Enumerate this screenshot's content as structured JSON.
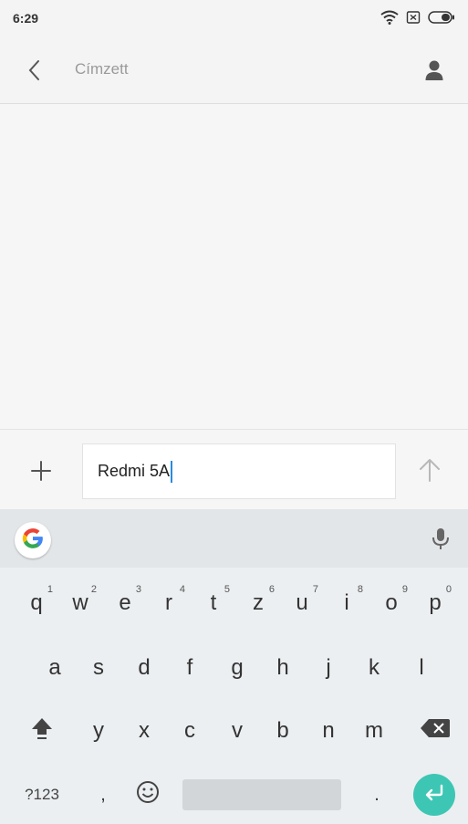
{
  "status_bar": {
    "time": "6:29",
    "icons": [
      "wifi-icon",
      "sim-off-icon",
      "battery-icon"
    ]
  },
  "header": {
    "back_icon": "chevron-left-icon",
    "recipient_placeholder": "Címzett",
    "contact_icon": "person-icon"
  },
  "compose": {
    "add_icon": "plus-icon",
    "message_text": "Redmi 5A",
    "send_icon": "arrow-up-icon"
  },
  "keyboard": {
    "suggestion_bar": {
      "g_icon": "google-g-icon",
      "mic_icon": "microphone-icon"
    },
    "row1": [
      {
        "label": "q",
        "hint": "1"
      },
      {
        "label": "w",
        "hint": "2"
      },
      {
        "label": "e",
        "hint": "3"
      },
      {
        "label": "r",
        "hint": "4"
      },
      {
        "label": "t",
        "hint": "5"
      },
      {
        "label": "z",
        "hint": "6"
      },
      {
        "label": "u",
        "hint": "7"
      },
      {
        "label": "i",
        "hint": "8"
      },
      {
        "label": "o",
        "hint": "9"
      },
      {
        "label": "p",
        "hint": "0"
      }
    ],
    "row2": [
      "a",
      "s",
      "d",
      "f",
      "g",
      "h",
      "j",
      "k",
      "l"
    ],
    "row3": [
      "y",
      "x",
      "c",
      "v",
      "b",
      "n",
      "m"
    ],
    "row3_icons": {
      "shift": "shift-icon",
      "backspace": "backspace-icon"
    },
    "row4": {
      "symbols_label": "?123",
      "comma_label": ",",
      "emoji_icon": "emoji-icon",
      "period_label": ".",
      "enter_icon": "enter-icon"
    },
    "accent_color": "#3ec6b4"
  }
}
